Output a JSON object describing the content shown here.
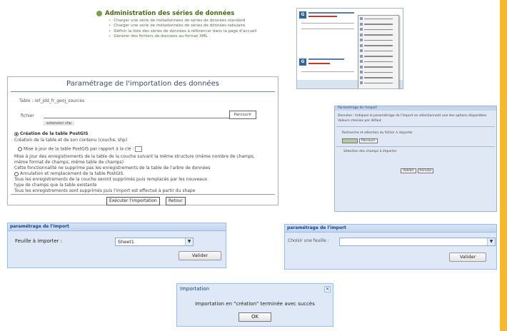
{
  "admin": {
    "title": "Administration des séries de données",
    "links": [
      "Charger une série de métadonnées de séries de données standard",
      "Charger une série de métadonnées de séries de données tabulaire",
      "Définir la liste des séries de données à référencer dans la page d'accueil",
      "Générer des fichiers de données au format XML"
    ]
  },
  "importation": {
    "title": "Paramétrage de l'importation des données",
    "table_line": "Table : ref_jdd_fr_geoj_sources",
    "file_label": "fichier",
    "browse_label": "Parcourir",
    "file_hint": "extension shp",
    "opt_create": "Création de la table PostGIS",
    "opt_create_desc": "Création de la table et de son contenu (couche, shp)",
    "opt_update": "Mise à jour de la table PostGIS par rapport à la clé :",
    "opt_update_desc1": "Mise à jour des enregistrements de la table de la couche suivant la même structure (même nombre de champs,",
    "opt_update_desc2": "même format de champs, même table de champs)",
    "opt_update_desc3": "Cette fonctionnalité ne supprime pas les enregistrements de la table de l'arbre de données",
    "opt_annul": "Annulation et remplacement de la table PostGIS",
    "opt_annul_desc1": "Tous les enregistrements de la couche seront supprimés puis remplacés par les nouveaux",
    "opt_annul_desc2": "type de champs que la table existante",
    "opt_annul_desc3": "Tous les enregistrements sont supprimés puis l'import est effectué à partir du shape",
    "btn_execute": "Exécuter l'importation",
    "btn_cancel": "Retour"
  },
  "rightpanel": {
    "header": "Paramétrage de l'import",
    "line1": "Données : Indiquez le paramétrage de l'import en sélectionnant une des options disponibles",
    "line2": "Valeurs choisies par défaut",
    "line3": "Recherche et sélection du fichier à importer",
    "browse": "Parcourir",
    "line4": "Sélection des champs à importer",
    "btn_validate": "Valider",
    "btn_cancel": "Annuler"
  },
  "panel_left": {
    "header": "paramétrage de l'import",
    "label": "Feuille à importer :",
    "value": "Sheet1",
    "button": "Valider"
  },
  "panel_right": {
    "header": "paramétrage de l'import",
    "label": "Choisir une feuille :",
    "value": "",
    "button": "Valider"
  },
  "dialog": {
    "title": "Importation",
    "close": "×",
    "message": "Importation en \"création\" terminée avec succès",
    "ok": "OK"
  },
  "colors": {
    "accent_strip": "#f5b82e",
    "panel_bg": "#dfe8f6",
    "panel_border": "#99bbe8",
    "admin_green": "#4a6a1a"
  }
}
